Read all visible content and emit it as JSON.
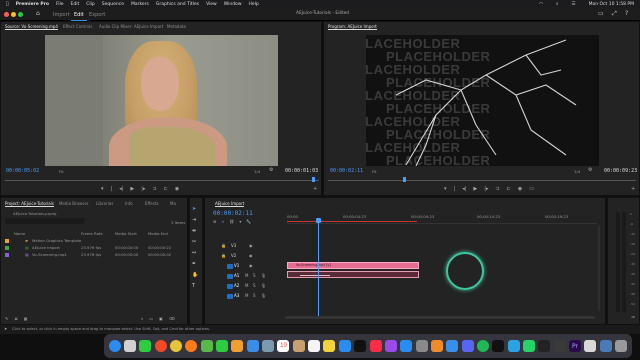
{
  "menubar": {
    "apple": "",
    "app": "Premiere Pro",
    "items": [
      "File",
      "Edit",
      "Clip",
      "Sequence",
      "Markers",
      "Graphics and Titles",
      "View",
      "Window",
      "Help"
    ],
    "clock": "Mon Oct 10  1:58 PM"
  },
  "toolbar": {
    "tabs": [
      "Import",
      "Edit",
      "Export"
    ],
    "project_title": "AEJuice-Tutorials - Edited"
  },
  "source": {
    "tabs": [
      "Source: Vo-Screening.mp4",
      "Effect Controls",
      "Audio Clip Mixer: AEJuice Import",
      "Metadata"
    ],
    "timecode": "00:00:05:02",
    "zoom": "Fit",
    "quality": "1/4",
    "duration": "00:00:01:03"
  },
  "program": {
    "tab": "Program: AEJuice Import",
    "timecode": "00:00:02:11",
    "zoom": "Fit",
    "quality": "1/4",
    "duration": "00:00:09:23",
    "placeholder_text": "PLACEHOLDER"
  },
  "project": {
    "tabs": [
      "Project: AEJuice-Tutorials",
      "Media Browser",
      "Libraries",
      "Info",
      "Effects",
      "Ma"
    ],
    "file": "AEJuice-Tutorials.prproj",
    "items_count": "3 Items",
    "columns": [
      "Name",
      "Frame Rate",
      "Media Start",
      "Media End"
    ],
    "rows": [
      {
        "name": "Motion Graphics Template",
        "rate": "",
        "start": "",
        "end": "",
        "color": "#e8a33a"
      },
      {
        "name": "AEJuice Import",
        "rate": "23.976 fps",
        "start": "00:00:00:00",
        "end": "00:00:00:22",
        "color": "#3aa84a"
      },
      {
        "name": "Vo-Screening.mp4",
        "rate": "23.976 fps",
        "start": "00:00:00:00",
        "end": "00:00:00:02",
        "color": "#8a5fd8"
      }
    ]
  },
  "timeline": {
    "tab": "AEJuice Import",
    "timecode": "00:00:02:11",
    "ruler": [
      "00:00",
      "00:00:04:23",
      "00:00:09:23",
      "00:00:14:23",
      "00:00:19:23"
    ],
    "video_tracks": [
      "V3",
      "V2",
      "V1"
    ],
    "audio_tracks": [
      "A1",
      "A2",
      "A3"
    ],
    "clip_label": "Vo-Screening.mp4 [V]",
    "audio_clip_label": ""
  },
  "statusbar": {
    "text": "Click to select, or click in empty space and drag to marquee select. Use Shift, Opt, and Cmd for other options."
  },
  "meter": {
    "labels": [
      "0",
      "-6",
      "-12",
      "-18",
      "-24",
      "-30",
      "-36",
      "-42",
      "-48",
      "-54"
    ],
    "unit": "dB"
  },
  "dock": {
    "calendar_day": "10",
    "icons": [
      {
        "name": "finder",
        "color": "#2b8cf0"
      },
      {
        "name": "launchpad",
        "color": "#d0d0d0"
      },
      {
        "name": "messages",
        "color": "#2ecc40"
      },
      {
        "name": "brave",
        "color": "#f04a28"
      },
      {
        "name": "chrome",
        "color": "#e8c43a"
      },
      {
        "name": "firefox",
        "color": "#ff7a1a"
      },
      {
        "name": "maps",
        "color": "#59b84a"
      },
      {
        "name": "facetime",
        "color": "#2ecc40"
      },
      {
        "name": "photos",
        "color": "#f0a030"
      },
      {
        "name": "mail",
        "color": "#3a8ee8"
      },
      {
        "name": "finder-2",
        "color": "#7a9ab0"
      },
      {
        "name": "calendar",
        "color": "#ffffff"
      },
      {
        "name": "contacts",
        "color": "#c8a070"
      },
      {
        "name": "reminders",
        "color": "#f4f4f4"
      },
      {
        "name": "notes",
        "color": "#f4d23a"
      },
      {
        "name": "freeform",
        "color": "#2b8cf0"
      },
      {
        "name": "apple-tv",
        "color": "#111111"
      },
      {
        "name": "music",
        "color": "#fa2d48"
      },
      {
        "name": "podcasts",
        "color": "#9a4ae8"
      },
      {
        "name": "app-store",
        "color": "#2b8cf0"
      },
      {
        "name": "system-settings",
        "color": "#8a8a8a"
      },
      {
        "name": "pages",
        "color": "#f08a2a"
      },
      {
        "name": "keynote",
        "color": "#3a8ee8"
      },
      {
        "name": "discord",
        "color": "#5865f2"
      },
      {
        "name": "spotify",
        "color": "#1db954"
      },
      {
        "name": "capcut",
        "color": "#111111"
      },
      {
        "name": "telegram",
        "color": "#2aa3e0"
      },
      {
        "name": "whatsapp",
        "color": "#25d366"
      },
      {
        "name": "obs",
        "color": "#222222"
      },
      {
        "name": "davinci",
        "color": "#3a3a3a"
      },
      {
        "name": "premiere",
        "color": "#2a0a4a"
      },
      {
        "name": "image-viewer",
        "color": "#d8d8d8"
      },
      {
        "name": "downloads",
        "color": "#4a7ab8"
      },
      {
        "name": "trash",
        "color": "#9a9a9a"
      }
    ]
  }
}
